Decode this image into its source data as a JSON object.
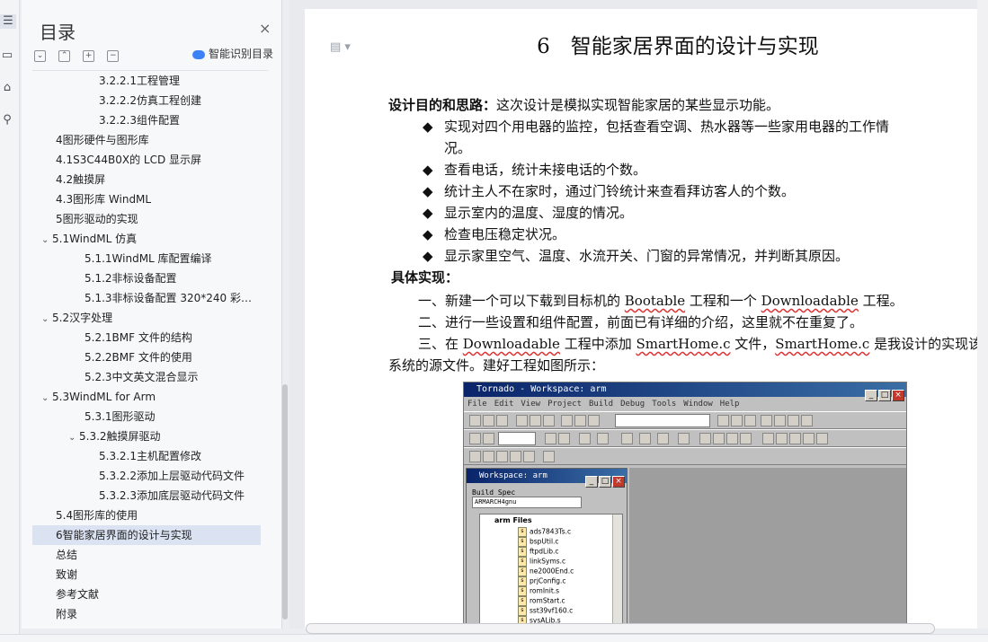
{
  "sidebar_icons": [
    "outline-icon",
    "page-icon",
    "bookmark-icon",
    "search-icon"
  ],
  "toc": {
    "title": "目录",
    "close": "×",
    "tools": [
      "⌄",
      "⌃",
      "+",
      "−"
    ],
    "smart_label": "智能识别目录",
    "items": [
      {
        "label": "3.2.2.1工程管理",
        "indent": 3
      },
      {
        "label": "3.2.2.2仿真工程创建",
        "indent": 3
      },
      {
        "label": "3.2.2.3组件配置",
        "indent": 3
      },
      {
        "label": "4图形硬件与图形库",
        "indent": 1
      },
      {
        "label": "4.1S3C44B0X的 LCD 显示屏",
        "indent": 1
      },
      {
        "label": "4.2触摸屏",
        "indent": 1
      },
      {
        "label": "4.3图形库 WindML",
        "indent": 1
      },
      {
        "label": "5图形驱动的实现",
        "indent": 1
      },
      {
        "label": "5.1WindML 仿真",
        "indent": 0,
        "chev": "⌄"
      },
      {
        "label": "5.1.1WindML 库配置编译",
        "indent": 2
      },
      {
        "label": "5.1.2非标设备配置",
        "indent": 2
      },
      {
        "label": "5.1.3非标设备配置 320*240 彩…",
        "indent": 2
      },
      {
        "label": "5.2汉字处理",
        "indent": 0,
        "chev": "⌄"
      },
      {
        "label": "5.2.1BMF 文件的结构",
        "indent": 2
      },
      {
        "label": "5.2.2BMF 文件的使用",
        "indent": 2
      },
      {
        "label": "5.2.3中文英文混合显示",
        "indent": 2
      },
      {
        "label": "5.3WindML for Arm",
        "indent": 0,
        "chev": "⌄"
      },
      {
        "label": "5.3.1图形驱动",
        "indent": 2
      },
      {
        "label": "5.3.2触摸屏驱动",
        "indent": 1.5,
        "chev": "⌄"
      },
      {
        "label": "5.3.2.1主机配置修改",
        "indent": 3
      },
      {
        "label": "5.3.2.2添加上层驱动代码文件",
        "indent": 3
      },
      {
        "label": "5.3.2.3添加底层驱动代码文件",
        "indent": 3
      },
      {
        "label": "5.4图形库的使用",
        "indent": 1
      },
      {
        "label": "6智能家居界面的设计与实现",
        "indent": 1,
        "selected": true
      },
      {
        "label": "总结",
        "indent": 1
      },
      {
        "label": "致谢",
        "indent": 1
      },
      {
        "label": "参考文献",
        "indent": 1
      },
      {
        "label": "附录",
        "indent": 1
      }
    ]
  },
  "doc": {
    "title": "6　智能家居界面的设计与实现",
    "goal_label": "设计目的和思路：",
    "goal_text": "这次设计是模拟实现智能家居的某些显示功能。",
    "bullets": [
      "实现对四个用电器的监控，包括查看空调、热水器等一些家用电器的工作情",
      "况。",
      "查看电话，统计未接电话的个数。",
      "统计主人不在家时，通过门铃统计来查看拜访客人的个数。",
      "显示室内的温度、湿度的情况。",
      "检查电压稳定状况。",
      "显示家里空气、温度、水流开关、门窗的异常情况，并判断其原因。"
    ],
    "impl_label": "具体实现：",
    "step1_pre": "一、新建一个可以下载到目标机的 ",
    "step1_a": "Bootable",
    "step1_mid": " 工程和一个 ",
    "step1_b": "Downloadable",
    "step1_post": " 工程。",
    "step2": "二、进行一些设置和组件配置，前面已有详细的介绍，这里就不在重复了。",
    "step3_pre": "三、在 ",
    "step3_a": "Downloadable",
    "step3_mid": " 工程中添加 ",
    "step3_b": "SmartHome.c",
    "step3_mid2": " 文件，",
    "step3_c": "SmartHome.c",
    "step3_post": " 是我设计的实现该",
    "step3_cont": "系统的源文件。建好工程如图所示："
  },
  "screenshot": {
    "app_title": "Tornado - Workspace: arm",
    "menu": [
      "File",
      "Edit",
      "View",
      "Project",
      "Build",
      "Debug",
      "Tools",
      "Window",
      "Help"
    ],
    "workspace_title": "Workspace: arm",
    "build_spec_label": "Build Spec",
    "build_spec_value": "ARMARCH4gnu",
    "root": "arm Files",
    "files": [
      "ads7843Ts.c",
      "bspUtil.c",
      "ftpdLib.c",
      "linkSyms.c",
      "ne2000End.c",
      "prjConfig.c",
      "romInit.s",
      "romStart.c",
      "sst39vf160.c",
      "sysALib.s"
    ]
  }
}
